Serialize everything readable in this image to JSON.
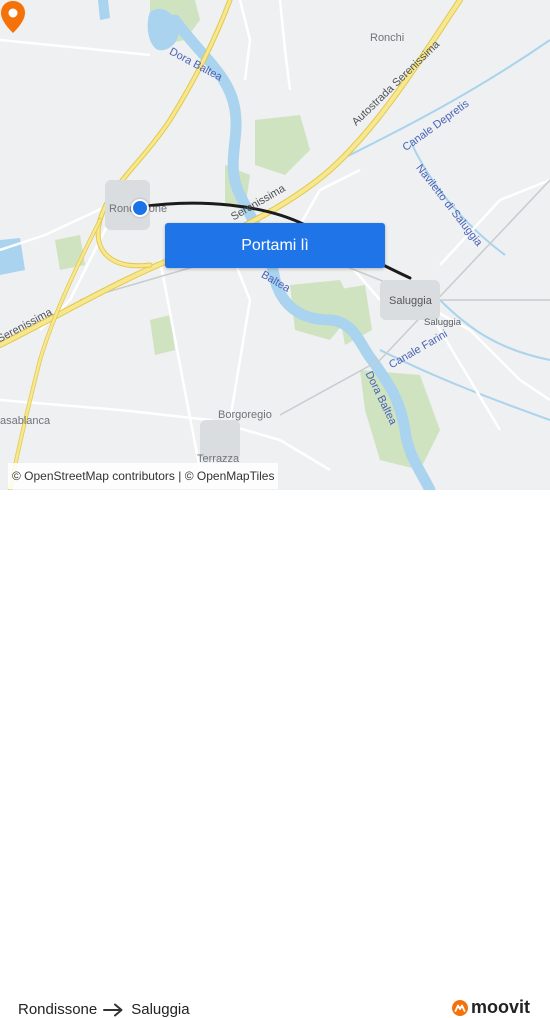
{
  "map": {
    "places": {
      "origin_label": "Rondissone",
      "ronchi": "Ronchi",
      "saluggia_label": "Saluggia",
      "saluggia_small": "Saluggia",
      "borgoregio": "Borgoregio",
      "terrazza": "Terrazza",
      "casablanca": "asablanca"
    },
    "roads": {
      "autostrada": "Autostrada Serenissima",
      "serenissima_mid": "Serenissima",
      "serenissima_left": "Serenissima"
    },
    "water": {
      "dora_baltea_top": "Dora Baltea",
      "dora_baltea_mid": "Baltea",
      "dora_baltea_low": "Dora Baltea",
      "canale_depretis": "Canale Depretis",
      "naviletto": "Naviletto di Saluggia",
      "canale_farini": "Canale Farini"
    },
    "colors": {
      "water": "#a9d3ee",
      "green": "#cfe3c1",
      "motorway": "#f4e07a",
      "route": "#1b1b1b",
      "marker_origin": "#1a73e8",
      "marker_destination": "#f5720a"
    },
    "icons": {
      "origin": "origin-marker-icon",
      "destination": "destination-pin-icon"
    }
  },
  "cta": {
    "label": "Portami lì"
  },
  "attribution": {
    "osm": "© OpenStreetMap contributors",
    "omt": "© OpenMapTiles"
  },
  "footer": {
    "origin": "Rondissone",
    "destination": "Saluggia",
    "arrow_icon": "arrow-right-icon",
    "brand": "moovit",
    "brand_color": "#f5720a"
  }
}
